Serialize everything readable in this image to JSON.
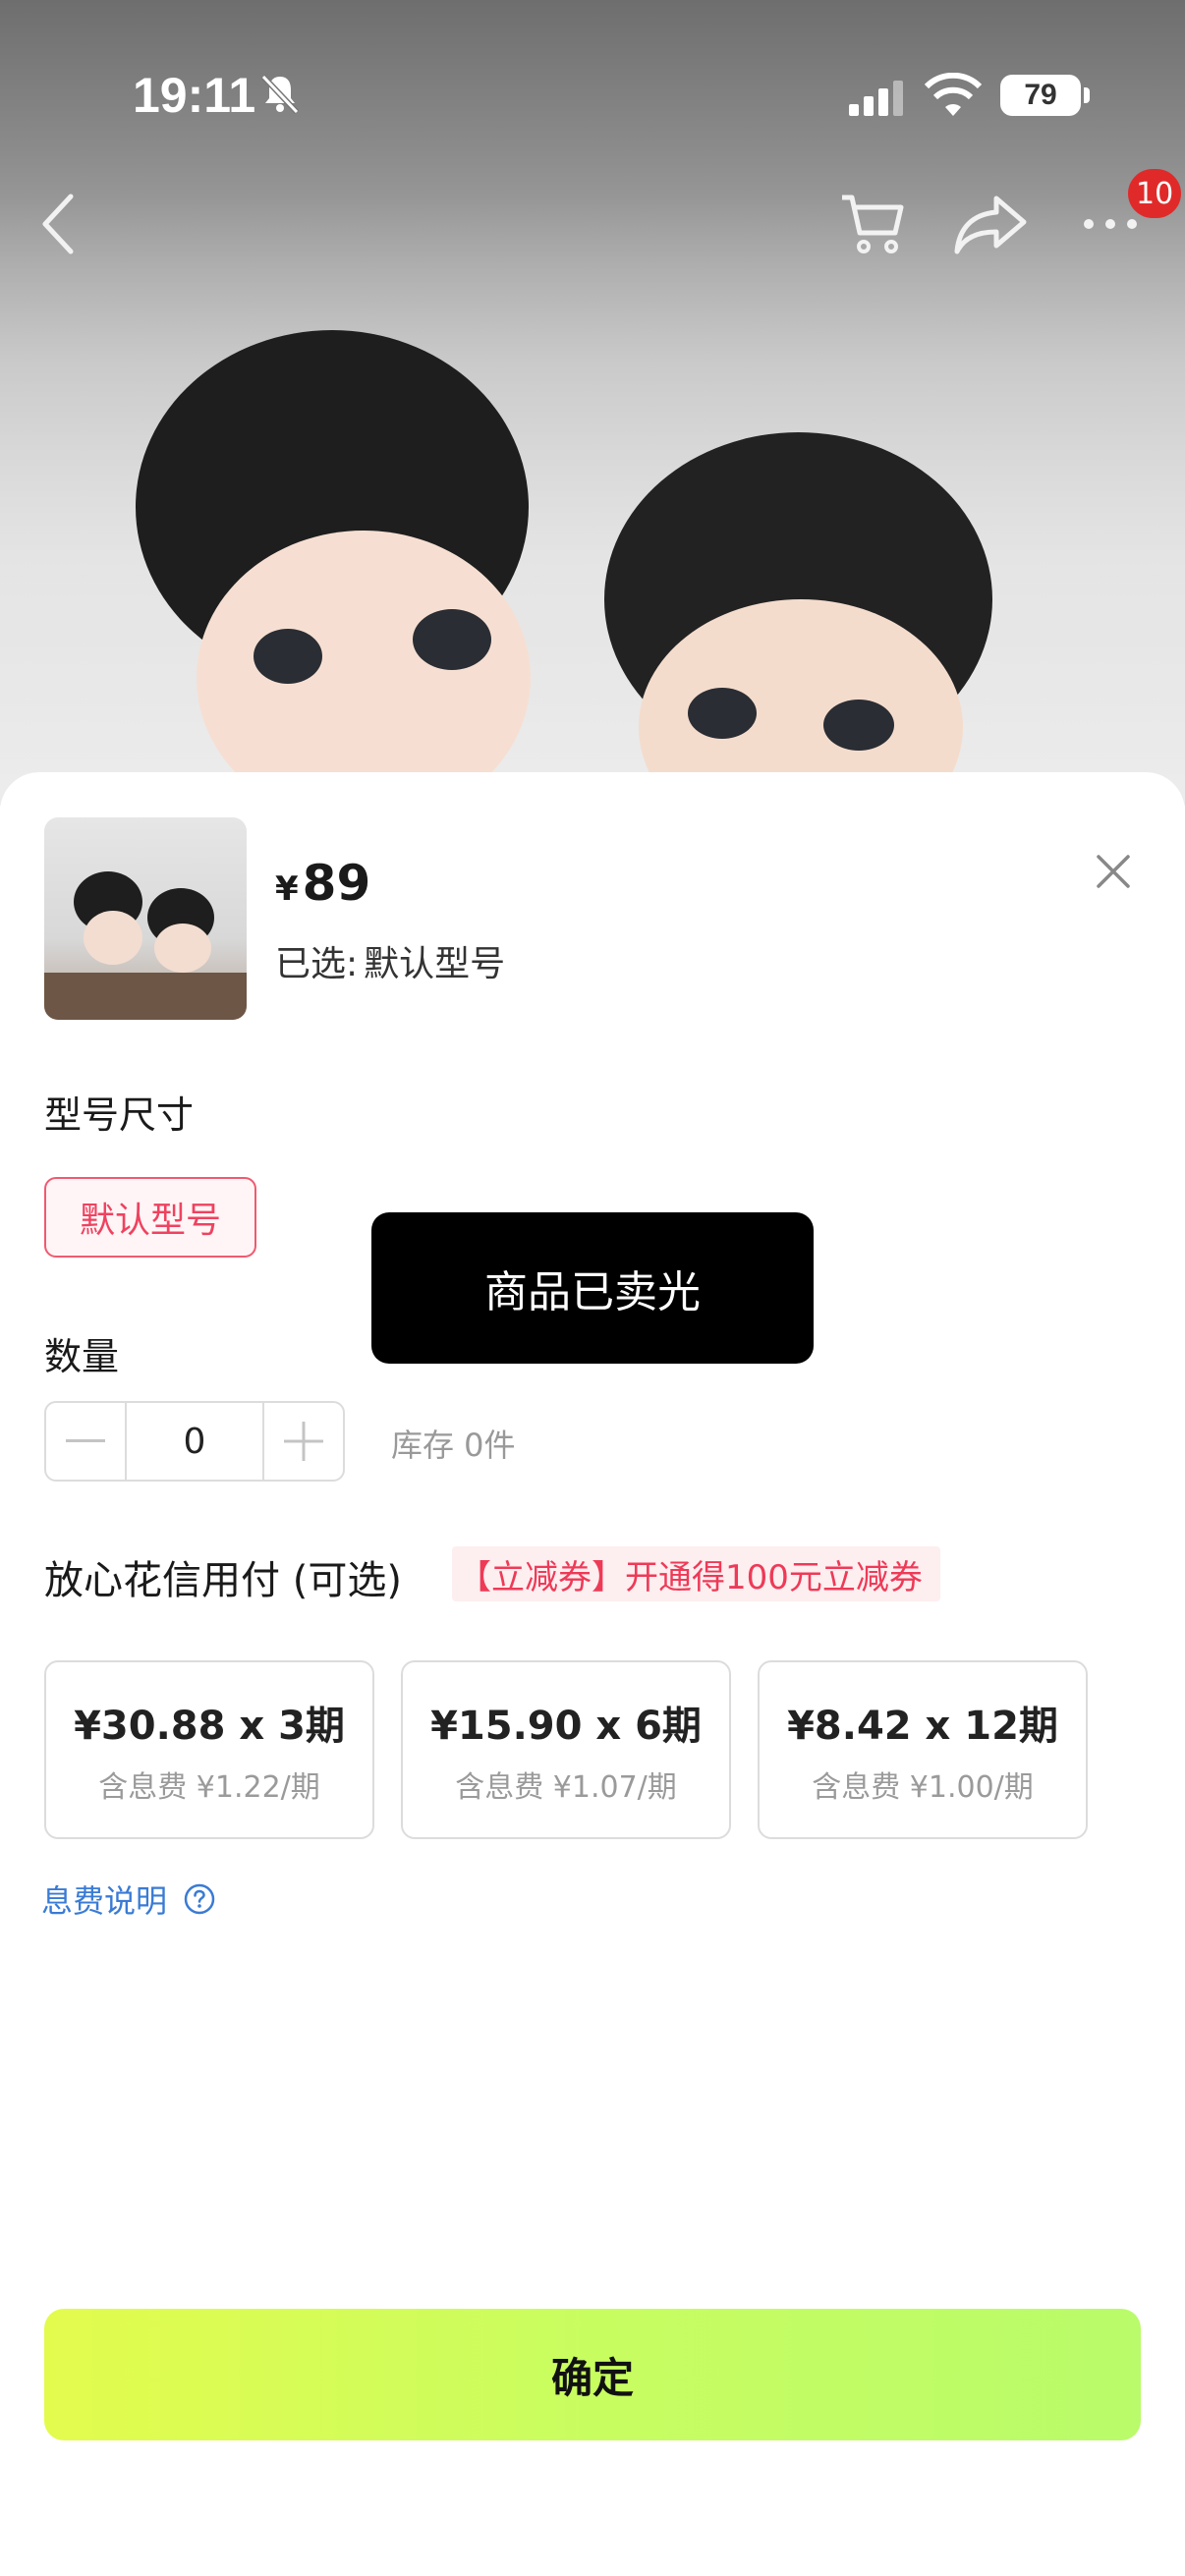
{
  "status_bar": {
    "time": "19:11",
    "battery": "79"
  },
  "nav": {
    "badge_count": "10",
    "icons": [
      "back-icon",
      "cart-icon",
      "share-icon",
      "more-icon"
    ]
  },
  "product": {
    "currency": "¥",
    "price": "89",
    "selected_label": "已选:",
    "selected_value": "默认型号"
  },
  "spec": {
    "section_label": "型号尺寸",
    "options": [
      "默认型号"
    ],
    "selected_option": "默认型号"
  },
  "quantity": {
    "section_label": "数量",
    "value": "0",
    "stock_text": "库存 0件"
  },
  "credit": {
    "title": "放心花信用付 (可选)",
    "coupon_tag": "【立减券】开通得100元立减券",
    "plans": [
      {
        "main": "¥30.88 x 3期",
        "fee": "含息费 ¥1.22/期"
      },
      {
        "main": "¥15.90 x 6期",
        "fee": "含息费 ¥1.07/期"
      },
      {
        "main": "¥8.42 x 12期",
        "fee": "含息费 ¥1.00/期"
      }
    ],
    "fee_note": "息费说明"
  },
  "toast": {
    "message": "商品已卖光"
  },
  "confirm_button": {
    "label": "确定"
  },
  "colors": {
    "accent_red": "#ef4260",
    "link_blue": "#3a7bd5",
    "confirm_gradient_start": "#e3fb4d",
    "confirm_gradient_end": "#b9fb6a",
    "badge_red": "#e02a2a"
  }
}
